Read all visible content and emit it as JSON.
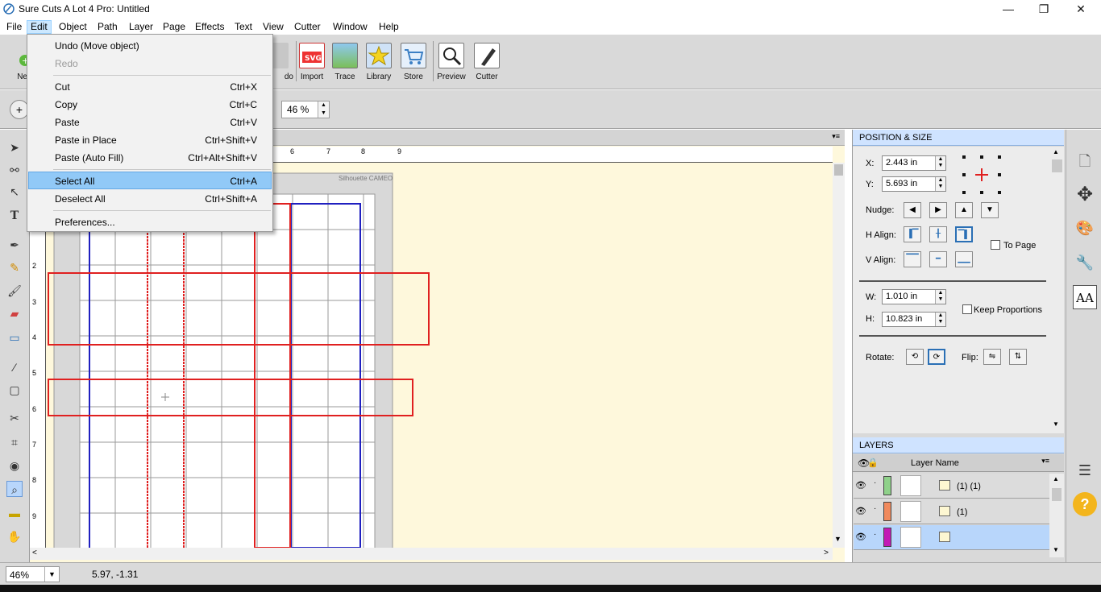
{
  "window": {
    "title": "Sure Cuts A Lot 4 Pro: Untitled",
    "minimize": "—",
    "maximize": "❐",
    "close": "✕"
  },
  "menubar": [
    "File",
    "Edit",
    "Object",
    "Path",
    "Layer",
    "Page",
    "Effects",
    "Text",
    "View",
    "Cutter",
    "Window",
    "Help"
  ],
  "toolbar": {
    "new_partial": "Ne",
    "undo_partial": "do",
    "items": [
      "Import",
      "Trace",
      "Library",
      "Store",
      "Preview",
      "Cutter"
    ]
  },
  "options": {
    "zoom": "46 %"
  },
  "edit_menu": {
    "undo": "Undo (Move object)",
    "redo": "Redo",
    "cut": "Cut",
    "cut_sc": "Ctrl+X",
    "copy": "Copy",
    "copy_sc": "Ctrl+C",
    "paste": "Paste",
    "paste_sc": "Ctrl+V",
    "paste_in_place": "Paste in Place",
    "paste_in_place_sc": "Ctrl+Shift+V",
    "paste_auto_fill": "Paste (Auto Fill)",
    "paste_auto_fill_sc": "Ctrl+Alt+Shift+V",
    "select_all": "Select All",
    "select_all_sc": "Ctrl+A",
    "deselect_all": "Deselect All",
    "deselect_all_sc": "Ctrl+Shift+A",
    "preferences": "Preferences..."
  },
  "canvas": {
    "mat_label": "Silhouette CAMEO",
    "ruler_top": [
      "6",
      "7",
      "8",
      "9"
    ],
    "ruler_left": [
      "2",
      "3",
      "4",
      "5",
      "6",
      "7",
      "8",
      "9"
    ]
  },
  "position_size": {
    "header": "POSITION & SIZE",
    "x_label": "X:",
    "x_value": "2.443 in",
    "y_label": "Y:",
    "y_value": "5.693 in",
    "nudge_label": "Nudge:",
    "halign_label": "H Align:",
    "valign_label": "V Align:",
    "to_page": "To Page",
    "w_label": "W:",
    "w_value": "1.010 in",
    "h_label": "H:",
    "h_value": "10.823 in",
    "keep_proportions": "Keep Proportions",
    "rotate_label": "Rotate:",
    "flip_label": "Flip:"
  },
  "layers": {
    "header": "LAYERS",
    "column": "Layer Name",
    "rows": [
      {
        "name": "(1) (1)",
        "color": "#8fd18a"
      },
      {
        "name": "(1)",
        "color": "#f08a5d"
      },
      {
        "name": "",
        "color": "#c21ab5"
      }
    ]
  },
  "status": {
    "zoom": "46%",
    "coords": "5.97, -1.31"
  }
}
